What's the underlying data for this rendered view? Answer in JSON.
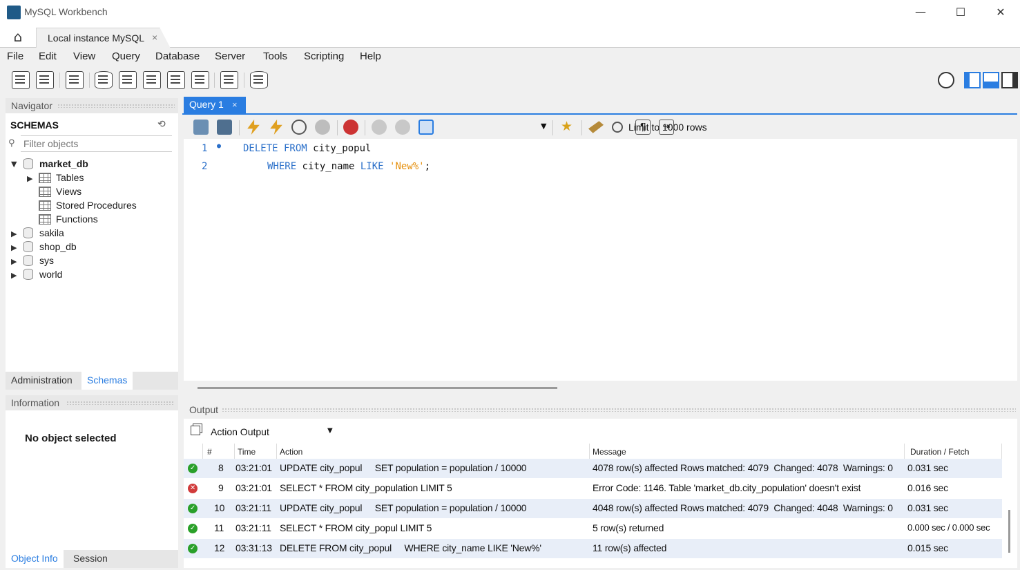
{
  "window": {
    "title": "MySQL Workbench",
    "minimize": "—",
    "maximize": "☐",
    "close": "✕"
  },
  "connection_tab": {
    "label": "Local instance MySQL",
    "close": "×"
  },
  "menu": [
    "File",
    "Edit",
    "View",
    "Query",
    "Database",
    "Server",
    "Tools",
    "Scripting",
    "Help"
  ],
  "navigator": {
    "header": "Navigator",
    "schemas_title": "SCHEMAS",
    "filter_placeholder": "Filter objects",
    "schemas": [
      {
        "name": "market_db",
        "expanded": true,
        "children": [
          "Tables",
          "Views",
          "Stored Procedures",
          "Functions"
        ]
      },
      {
        "name": "sakila"
      },
      {
        "name": "shop_db"
      },
      {
        "name": "sys"
      },
      {
        "name": "world"
      }
    ],
    "tabs": [
      "Administration",
      "Schemas"
    ]
  },
  "information": {
    "header": "Information",
    "empty_text": "No object selected",
    "tabs": [
      "Object Info",
      "Session"
    ]
  },
  "query_tab": {
    "label": "Query 1",
    "close": "×"
  },
  "query_toolbar": {
    "limit": "Limit to 1000 rows"
  },
  "editor": {
    "lines": [
      {
        "n": "1",
        "kw1": "DELETE FROM",
        "rest1": " city_popul"
      },
      {
        "n": "2",
        "kw1": "WHERE",
        "rest1": " city_name ",
        "kw2": "LIKE",
        "str": "'New%'",
        "end": ";"
      }
    ]
  },
  "output": {
    "header": "Output",
    "type": "Action Output",
    "columns": [
      "#",
      "Time",
      "Action",
      "Message",
      "Duration / Fetch"
    ],
    "rows": [
      {
        "status": "ok",
        "num": "8",
        "time": "03:21:01",
        "action": "UPDATE city_popul     SET population = population / 10000",
        "message": "4078 row(s) affected Rows matched: 4079  Changed: 4078  Warnings: 0",
        "duration": "0.031 sec"
      },
      {
        "status": "error",
        "num": "9",
        "time": "03:21:01",
        "action": "SELECT * FROM city_population LIMIT 5",
        "message": "Error Code: 1146. Table 'market_db.city_population' doesn't exist",
        "duration": "0.016 sec"
      },
      {
        "status": "ok",
        "num": "10",
        "time": "03:21:11",
        "action": "UPDATE city_popul     SET population = population / 10000",
        "message": "4048 row(s) affected Rows matched: 4079  Changed: 4048  Warnings: 0",
        "duration": "0.031 sec"
      },
      {
        "status": "ok",
        "num": "11",
        "time": "03:21:11",
        "action": "SELECT * FROM city_popul LIMIT 5",
        "message": "5 row(s) returned",
        "duration": "0.000 sec / 0.000 sec"
      },
      {
        "status": "ok",
        "num": "12",
        "time": "03:31:13",
        "action": "DELETE FROM city_popul     WHERE city_name LIKE 'New%'",
        "message": "11 row(s) affected",
        "duration": "0.015 sec"
      }
    ]
  }
}
